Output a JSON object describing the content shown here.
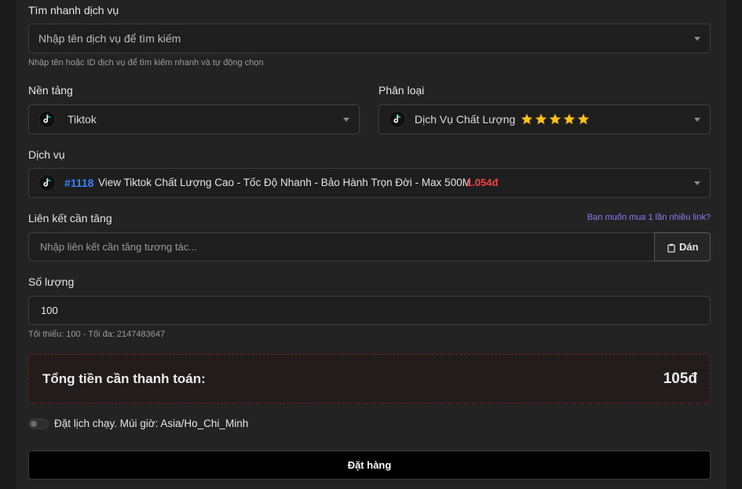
{
  "quick_search": {
    "label": "Tìm nhanh dịch vụ",
    "placeholder": "Nhập tên dịch vụ để tìm kiếm",
    "help": "Nhập tên hoặc ID dịch vụ để tìm kiếm nhanh và tự động chọn"
  },
  "platform": {
    "label": "Nền tảng",
    "selected": "Tiktok",
    "icon": "tiktok-icon"
  },
  "category": {
    "label": "Phân loại",
    "selected": "Dịch Vụ Chất Lượng",
    "stars": 5,
    "icon": "tiktok-icon"
  },
  "service": {
    "label": "Dịch vụ",
    "id": "#1118",
    "name": "View Tiktok Chất Lượng Cao - Tốc Độ Nhanh - Bảo Hành Trọn Đời - Max 500M",
    "price": "1.054đ",
    "icon": "tiktok-icon"
  },
  "link": {
    "label": "Liên kết cần tăng",
    "multi_link": "Bạn muốn mua 1 lần nhiều link?",
    "placeholder": "Nhập liên kết cần tăng tương tác...",
    "paste_label": "Dán",
    "paste_icon": "clipboard-icon"
  },
  "quantity": {
    "label": "Số lượng",
    "value": "100",
    "help": "Tối thiểu: 100 - Tối đa: 2147483647"
  },
  "total": {
    "label": "Tổng tiền cần thanh toán:",
    "amount": "105đ"
  },
  "schedule": {
    "label": "Đặt lịch chạy. Múi giờ: Asia/Ho_Chi_Minh",
    "enabled": false
  },
  "order_button": "Đặt hàng",
  "colors": {
    "panel": "#232323",
    "input_bg": "#1e1e1e",
    "accent_blue": "#3b82f6",
    "price_red": "#ef4444",
    "total_border": "#7a1d1d",
    "star": "#f5c518",
    "link_purple": "#8b7cf6"
  }
}
